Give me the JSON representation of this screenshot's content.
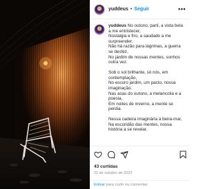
{
  "post": {
    "username": "yuddeus",
    "separator": "•",
    "follow_label": "Seguir",
    "more_icon": "more-horizontal-icon",
    "caption_lines": [
      [
        "No outono, parti, a vista bela",
        "a me entristecer,",
        "Nostalgia e frio, a saudade a me",
        "surpreender.",
        "Não há razão para lágrimas, a guerra",
        "se desfez,",
        "No jardim de nossas mentes, sonhos",
        "outra vez."
      ],
      [
        "Sob o sol brilhante, só nós, em",
        "contemplação,",
        "No escuro jardim, um pacto, nossa",
        "imaginação.",
        "Nas asas do outono, a melancolia e a",
        "poesia,",
        "Em noites de inverno, a mente se",
        "perdia."
      ],
      [
        "Nessa cadeira imaginária à beira-mar,",
        "Na escuridão das mentes, nossa",
        "história a se revelar."
      ]
    ],
    "likes": "43 curtidas",
    "date": "22 de outubro de 2023",
    "comment_login": "Entrar",
    "comment_rest": " para curtir ou comentar."
  },
  "icons": {
    "like": "heart-icon",
    "comment": "comment-icon",
    "share": "send-icon",
    "save": "bookmark-icon"
  },
  "colors": {
    "accent": "#0095f6",
    "text": "#262626",
    "muted": "#8e8e8e",
    "photo_background": "#0d0a08",
    "wall_light": "#c8641e"
  }
}
